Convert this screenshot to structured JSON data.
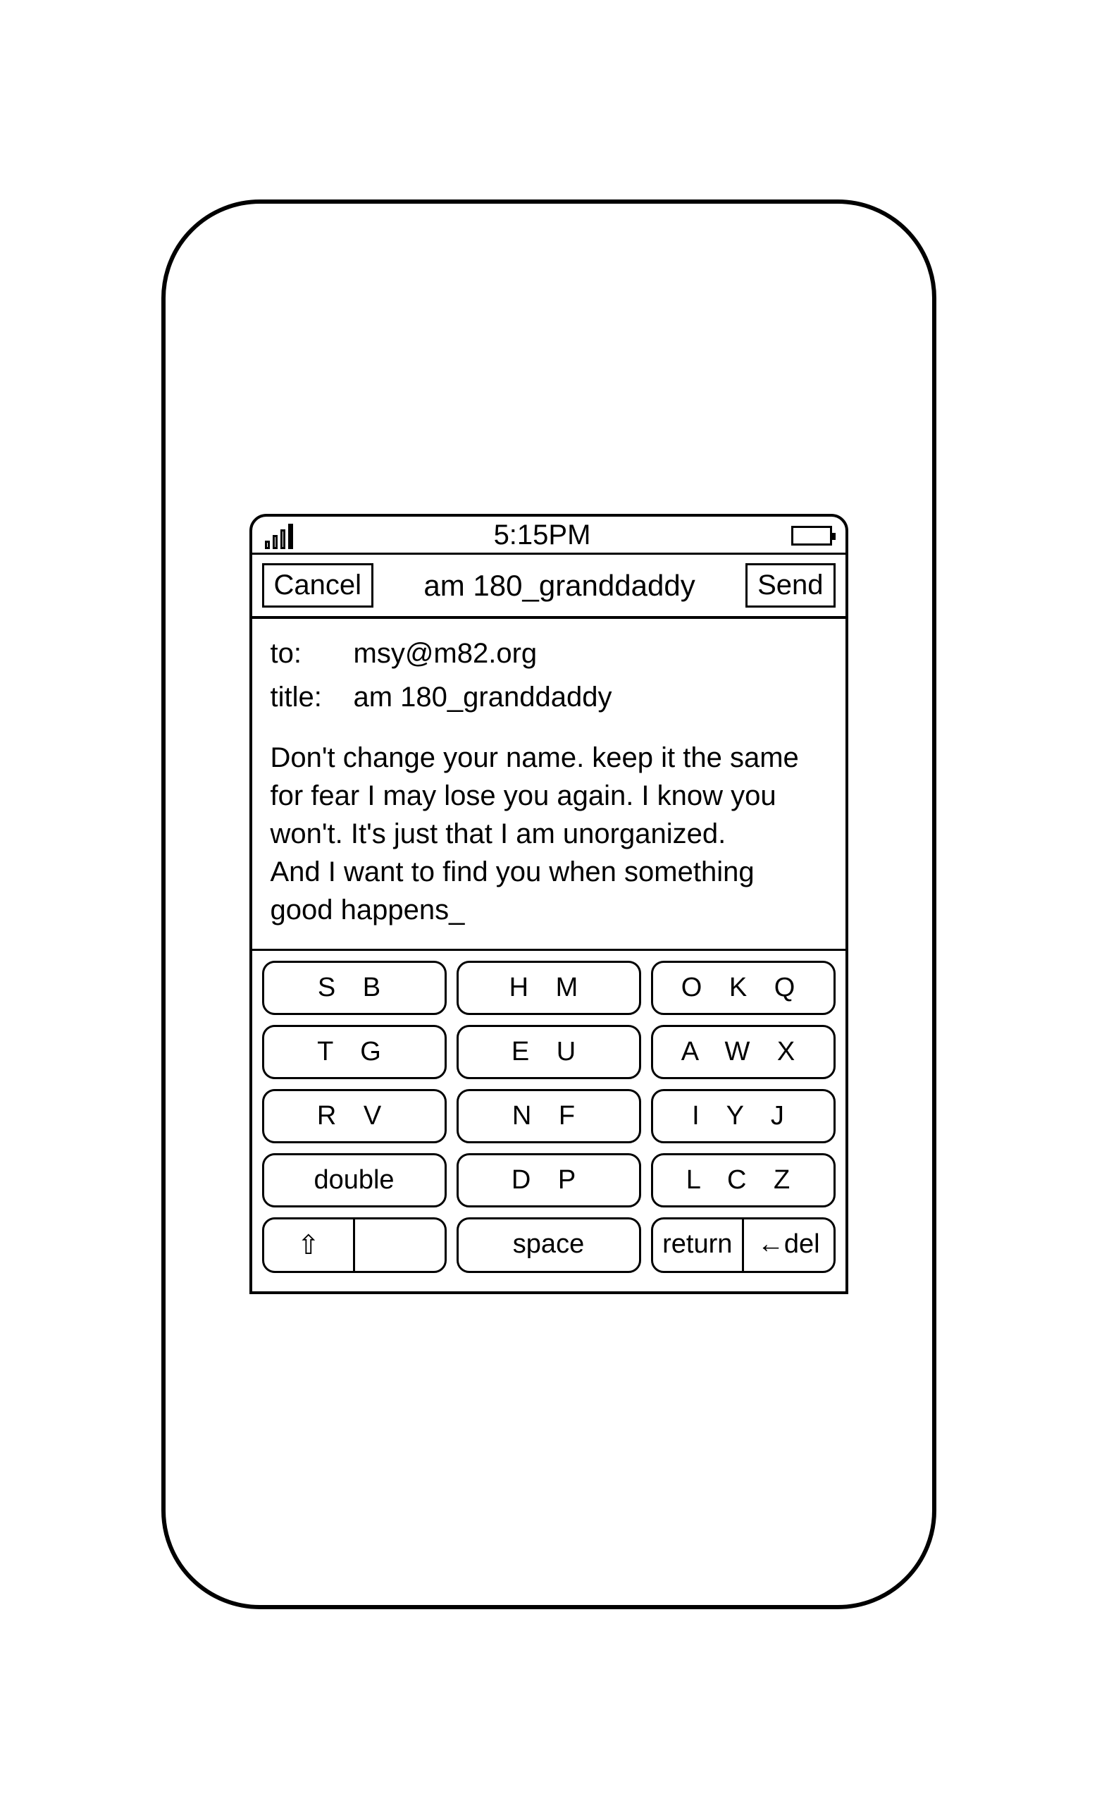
{
  "status": {
    "time": "5:15PM"
  },
  "nav": {
    "cancel": "Cancel",
    "title": "am 180_granddaddy",
    "send": "Send"
  },
  "compose": {
    "to_label": "to:",
    "to_value": "msy@m82.org",
    "title_label": "title:",
    "title_value": "am 180_granddaddy",
    "body": "Don't change your name. keep it the same for fear I may lose you again. I know you won't. It's just that I am unorganized.\nAnd I want to find you when something\ngood happens_"
  },
  "keyboard": {
    "rows": [
      [
        "S   B",
        "H   M",
        "O  K  Q"
      ],
      [
        "T   G",
        "E   U",
        "A  W  X"
      ],
      [
        "R   V",
        "N   F",
        "I   Y   J"
      ],
      [
        "double",
        "D   P",
        "L   C   Z"
      ]
    ],
    "shift": "⇧",
    "space": "space",
    "return": "return",
    "del": "←del"
  }
}
